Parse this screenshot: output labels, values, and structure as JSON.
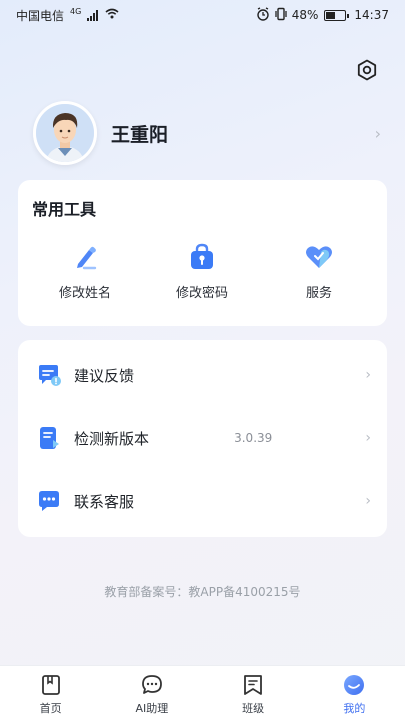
{
  "status": {
    "carrier": "中国电信",
    "net": "4G",
    "battery": "48%",
    "time": "14:37",
    "battery_level": 0.48
  },
  "profile": {
    "name": "王重阳"
  },
  "tools": {
    "title": "常用工具",
    "items": [
      {
        "label": "修改姓名",
        "icon": "pencil-icon"
      },
      {
        "label": "修改密码",
        "icon": "lock-icon"
      },
      {
        "label": "服务",
        "icon": "heart-icon"
      }
    ]
  },
  "menu": {
    "items": [
      {
        "label": "建议反馈",
        "value": "",
        "icon": "feedback-icon"
      },
      {
        "label": "检测新版本",
        "value": "3.0.39",
        "icon": "document-icon"
      },
      {
        "label": "联系客服",
        "value": "",
        "icon": "chat-icon"
      }
    ]
  },
  "footer": {
    "icp": "教育部备案号：教APP备4100215号"
  },
  "tabbar": {
    "items": [
      {
        "label": "首页",
        "icon": "book-icon"
      },
      {
        "label": "AI助理",
        "icon": "message-icon"
      },
      {
        "label": "班级",
        "icon": "bookmark-icon"
      },
      {
        "label": "我的",
        "icon": "profile-circle-icon"
      }
    ],
    "active": "我的"
  },
  "colors": {
    "accent": "#3f6ff0",
    "icon_blue": "#3b82f6",
    "background": "#f2f3f7"
  }
}
